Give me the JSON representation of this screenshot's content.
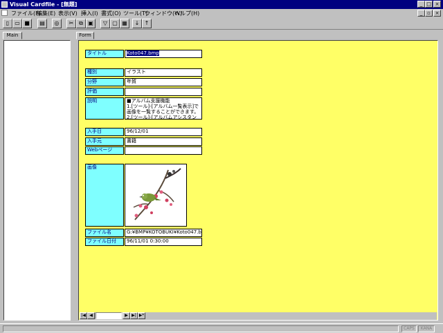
{
  "window": {
    "title": "Visual Cardfile - [無題]"
  },
  "menu": [
    "ファイル(F)",
    "編集(E)",
    "表示(V)",
    "挿入(I)",
    "書式(O)",
    "ツール(T)",
    "ウィンドウ(W)",
    "ヘルプ(H)"
  ],
  "tabs": {
    "left": "Main",
    "right": "Form"
  },
  "form": {
    "title_label": "タイトル",
    "title_value": "Koto047.bmp",
    "kind_label": "種別",
    "kind_value": "イラスト",
    "field_label": "分野",
    "field_value": "年賀",
    "rating_label": "評価",
    "rating_value": "",
    "desc_label": "説明",
    "desc_value": "■アルバム支援機能\n1.[ツール]-[アルバム一覧表示]で\n画像を一覧することができます。\n2.[ツール]-[アルバムアシスタント]",
    "date_label": "入手日",
    "date_value": "96/12/01",
    "source_label": "入手元",
    "source_value": "書籍",
    "web_label": "Webページ",
    "web_value": "",
    "image_label": "画像",
    "filename_label": "ファイル名",
    "filename_value": "G:¥BMP¥KOTOBUKI¥Koto047.bmp",
    "filedate_label": "ファイル日付",
    "filedate_value": "96/11/01 0:30:00"
  },
  "status": {
    "caps": "CAPS",
    "kana": "KANA"
  }
}
